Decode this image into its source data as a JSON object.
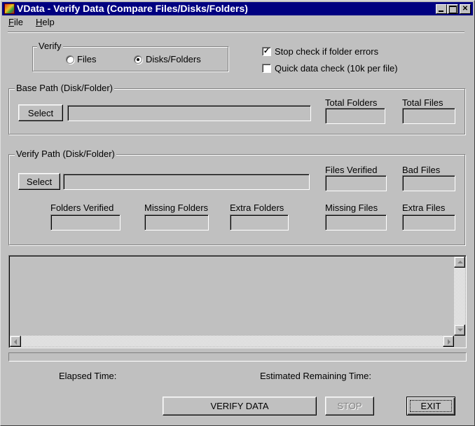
{
  "window": {
    "title": "VData - Verify Data (Compare Files/Disks/Folders)",
    "controls": {
      "minimize": "minimize",
      "maximize": "maximize",
      "close": "close"
    }
  },
  "menu": {
    "items": [
      {
        "label": "File",
        "mnemonic": "F",
        "rest": "ile"
      },
      {
        "label": "Help",
        "mnemonic": "H",
        "rest": "elp"
      }
    ]
  },
  "verify_group": {
    "title": "Verify",
    "options": [
      {
        "label": "Files",
        "selected": false
      },
      {
        "label": "Disks/Folders",
        "selected": true
      }
    ]
  },
  "options": {
    "stop_on_folder_errors": {
      "label": "Stop check if folder errors",
      "checked": true
    },
    "quick_data_check": {
      "label": "Quick data check (10k per file)",
      "checked": false
    }
  },
  "base_path": {
    "title": "Base Path (Disk/Folder)",
    "select_label": "Select",
    "path_value": "",
    "total_folders_label": "Total Folders",
    "total_folders_value": "",
    "total_files_label": "Total Files",
    "total_files_value": ""
  },
  "verify_path": {
    "title": "Verify Path (Disk/Folder)",
    "select_label": "Select",
    "path_value": "",
    "files_verified_label": "Files Verified",
    "files_verified_value": "",
    "bad_files_label": "Bad Files",
    "bad_files_value": "",
    "folders_verified_label": "Folders Verified",
    "folders_verified_value": "",
    "missing_folders_label": "Missing Folders",
    "missing_folders_value": "",
    "extra_folders_label": "Extra Folders",
    "extra_folders_value": "",
    "missing_files_label": "Missing Files",
    "missing_files_value": "",
    "extra_files_label": "Extra Files",
    "extra_files_value": ""
  },
  "log": {
    "lines": []
  },
  "progress": {
    "percent": 0
  },
  "status": {
    "elapsed_label": "Elapsed Time:",
    "elapsed_value": "",
    "remaining_label": "Estimated Remaining Time:",
    "remaining_value": ""
  },
  "actions": {
    "verify_label": "VERIFY DATA",
    "stop_label": "STOP",
    "stop_enabled": false,
    "exit_label": "EXIT"
  }
}
